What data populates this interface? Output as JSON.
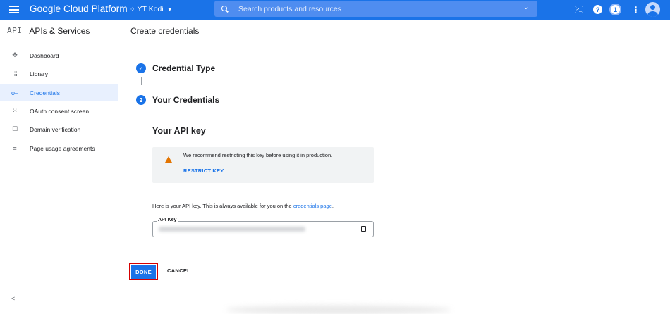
{
  "topbar": {
    "brand": "Google Cloud Platform",
    "project": "YT Kodi",
    "search_placeholder": "Search products and resources",
    "notification_count": "1"
  },
  "sidebar": {
    "api_label": "API",
    "title": "APIs & Services",
    "items": [
      {
        "label": "Dashboard",
        "icon": "dashboard-icon"
      },
      {
        "label": "Library",
        "icon": "library-icon"
      },
      {
        "label": "Credentials",
        "icon": "key-icon",
        "active": true
      },
      {
        "label": "OAuth consent screen",
        "icon": "oauth-icon"
      },
      {
        "label": "Domain verification",
        "icon": "domain-icon"
      },
      {
        "label": "Page usage agreements",
        "icon": "agreements-icon"
      }
    ],
    "collapse": "<|"
  },
  "page": {
    "title": "Create credentials",
    "steps": [
      {
        "number": "✓",
        "label": "Credential Type"
      },
      {
        "number": "2",
        "label": "Your Credentials"
      }
    ],
    "apikey_title": "Your API key",
    "warning_text": "We recommend restricting this key before using it in production.",
    "restrict_label": "RESTRICT KEY",
    "info_text": "Here is your API key. This is always available for you on the",
    "info_link": "credentials page",
    "info_end": ".",
    "key_label": "API Key",
    "done_label": "DONE",
    "cancel_label": "CANCEL"
  },
  "colors": {
    "accent": "#1a73e8",
    "warning": "#e37400",
    "highlight_border": "#d50000"
  }
}
